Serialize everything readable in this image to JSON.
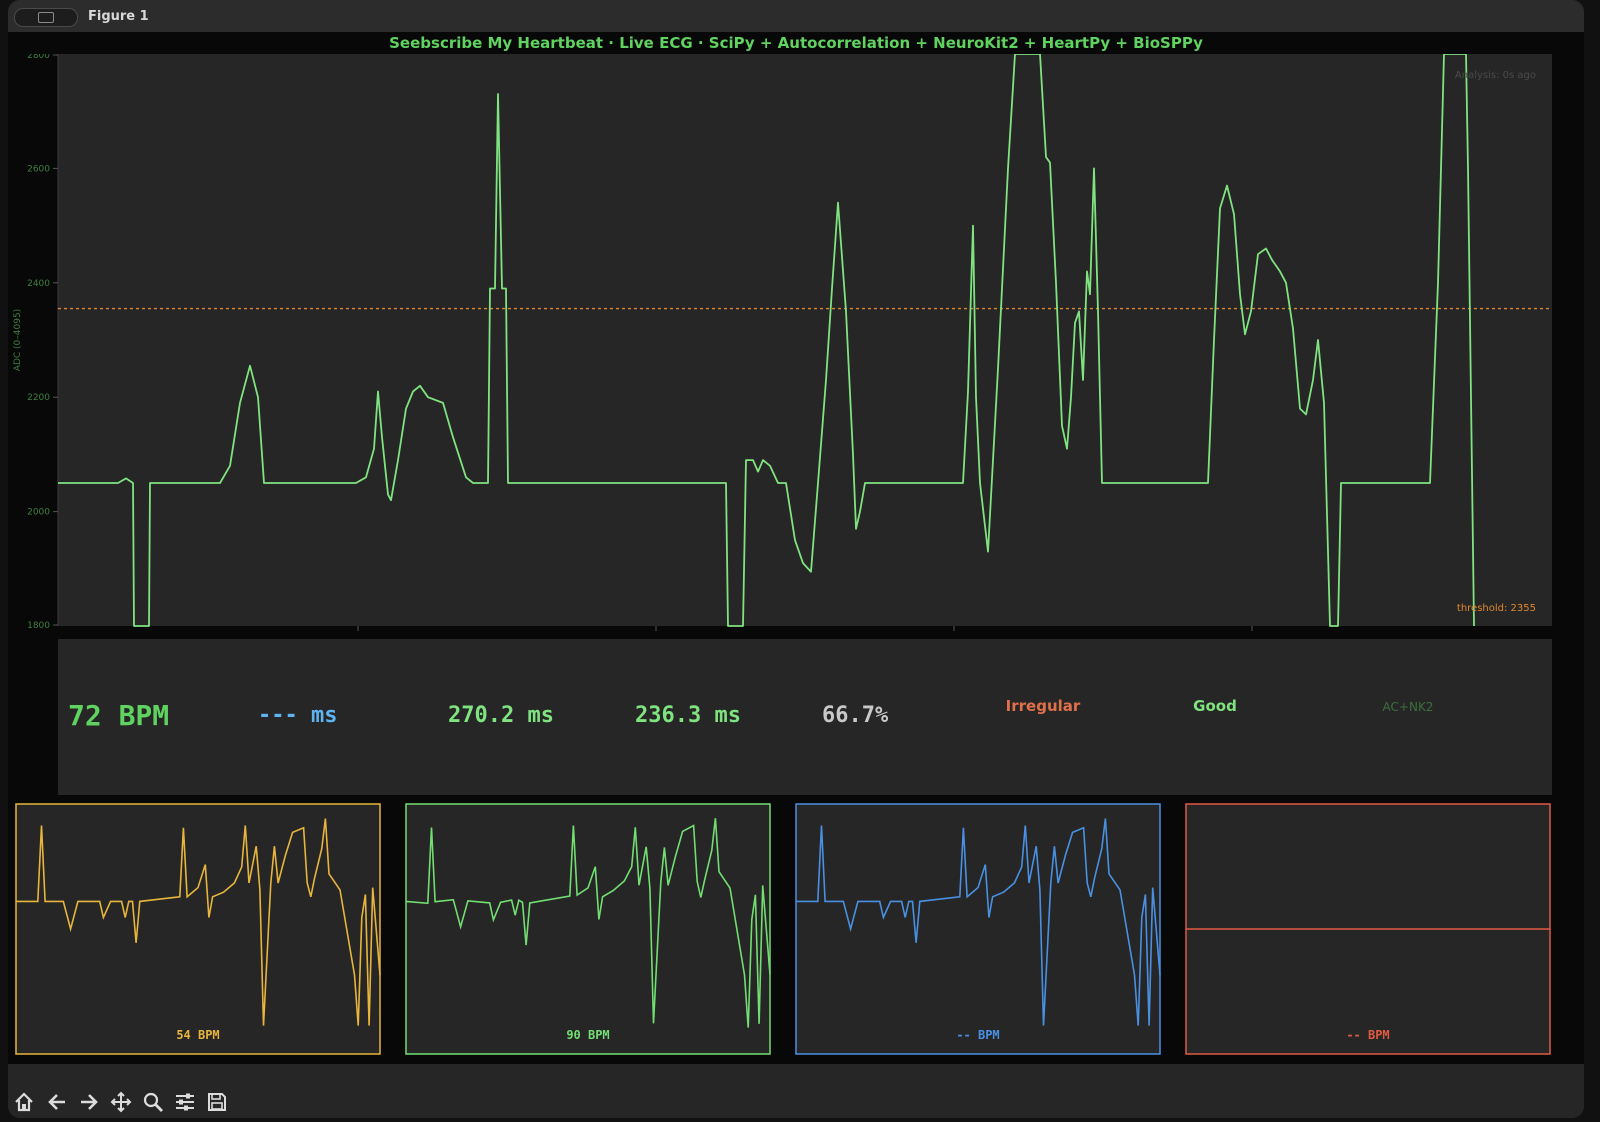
{
  "window": {
    "title": "Figure 1"
  },
  "figure": {
    "title": "Seebscribe My Heartbeat  ·  Live ECG  ·  SciPy + Autocorrelation + NeuroKit2 + HeartPy + BioSPPy"
  },
  "main_plot": {
    "ylabel": "ADC (0–4095)",
    "ylim": [
      1800,
      2800
    ],
    "yticks": [
      "1800",
      "2000",
      "2200",
      "2400",
      "2600",
      "2800"
    ],
    "threshold_value": 2355,
    "threshold_label": "threshold: 2355",
    "status_label": "Analysis: 0s ago",
    "trace_color": "#7fe37f",
    "threshold_color": "#e0872e"
  },
  "metrics": {
    "bpm": "72 BPM",
    "rr": "--- ms",
    "sdnn": "270.2 ms",
    "rmssd": "236.3 ms",
    "pct": "66.7%",
    "rhythm": "Irregular",
    "quality": "Good",
    "method": "AC+NK2"
  },
  "mini_plots": [
    {
      "label": "54 BPM",
      "color": "#e7b53c"
    },
    {
      "label": "90 BPM",
      "color": "#72de72"
    },
    {
      "label": "-- BPM",
      "color": "#4a90e2"
    },
    {
      "label": "-- BPM",
      "color": "#e05a42"
    }
  ],
  "toolbar": {
    "icons": [
      "home-icon",
      "back-arrow-icon",
      "forward-arrow-icon",
      "pan-icon",
      "zoom-icon",
      "configure-subplots-icon",
      "save-icon"
    ]
  }
}
